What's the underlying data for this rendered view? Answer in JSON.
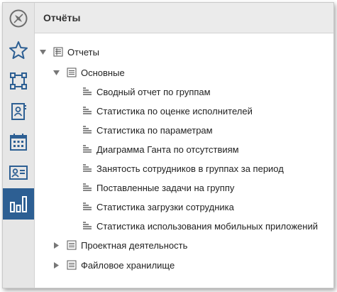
{
  "header": {
    "title": "Отчёты"
  },
  "colors": {
    "accent": "#2d5f93",
    "icon": "#2d5f93",
    "sidebar_bg": "#e6e6e6",
    "header_bg": "#ebebeb"
  },
  "sidebar": {
    "items": [
      {
        "icon": "compass-icon"
      },
      {
        "icon": "star-icon"
      },
      {
        "icon": "workflow-icon"
      },
      {
        "icon": "contact-card-icon"
      },
      {
        "icon": "calendar-icon"
      },
      {
        "icon": "id-card-icon"
      },
      {
        "icon": "bar-chart-icon",
        "active": true
      }
    ]
  },
  "tree": {
    "root": {
      "label": "Отчеты",
      "expanded": true
    },
    "groups": [
      {
        "label": "Основные",
        "expanded": true,
        "items": [
          "Сводный отчет по группам",
          "Статистика по оценке исполнителей",
          "Статистика по параметрам",
          "Диаграмма Ганта по отсутствиям",
          "Занятость сотрудников в группах за период",
          "Поставленные задачи на группу",
          "Статистика загрузки сотрудника",
          "Статистика использования мобильных приложений"
        ]
      },
      {
        "label": "Проектная деятельность",
        "expanded": false,
        "items": []
      },
      {
        "label": "Файловое хранилище",
        "expanded": false,
        "items": []
      }
    ]
  }
}
